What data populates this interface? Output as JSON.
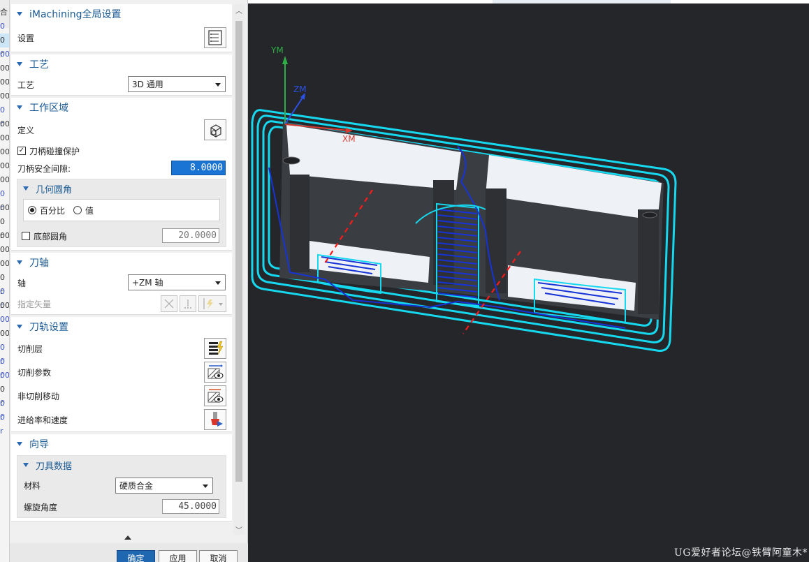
{
  "left_strip": {
    "rows": [
      {
        "text": "合",
        "style": "normal"
      },
      {
        "text": "0",
        "style": "blue"
      },
      {
        "text": "0 r",
        "style": "sel"
      },
      {
        "text": "00",
        "style": "blue"
      },
      {
        "text": "00",
        "style": "normal"
      },
      {
        "text": "00",
        "style": "normal"
      },
      {
        "text": "00",
        "style": "normal"
      },
      {
        "text": "0 r",
        "style": "blue"
      },
      {
        "text": "00",
        "style": "normal"
      },
      {
        "text": "00",
        "style": "normal"
      },
      {
        "text": "00",
        "style": "normal"
      },
      {
        "text": "00",
        "style": "normal"
      },
      {
        "text": "00",
        "style": "normal"
      },
      {
        "text": "0 r",
        "style": "blue"
      },
      {
        "text": "00",
        "style": "normal"
      },
      {
        "text": "0 r",
        "style": "normal"
      },
      {
        "text": "00",
        "style": "normal"
      },
      {
        "text": "00",
        "style": "normal"
      },
      {
        "text": "00",
        "style": "normal"
      },
      {
        "text": "0 r",
        "style": "normal"
      },
      {
        "text": "0 r",
        "style": "blue"
      },
      {
        "text": "00",
        "style": "normal"
      },
      {
        "text": "00",
        "style": "blue"
      },
      {
        "text": "00",
        "style": "normal"
      },
      {
        "text": "0 r",
        "style": "blue"
      },
      {
        "text": "0 r",
        "style": "blue"
      },
      {
        "text": "00",
        "style": "blue"
      },
      {
        "text": "0 r",
        "style": "normal"
      },
      {
        "text": "0 r",
        "style": "blue"
      },
      {
        "text": "0 r",
        "style": "blue"
      }
    ]
  },
  "dialog": {
    "global": {
      "title": "iMachining全局设置",
      "settings_label": "设置"
    },
    "process": {
      "title": "工艺",
      "label": "工艺",
      "value": "3D 通用"
    },
    "work_area": {
      "title": "工作区域",
      "define_label": "定义",
      "holder_collision_label": "刀柄碰撞保护",
      "holder_collision_checked": true,
      "holder_clearance_label": "刀柄安全间隙:",
      "holder_clearance_value": "8.0000",
      "fillet": {
        "title": "几何圆角",
        "radio_percent": "百分比",
        "radio_value": "值",
        "selected": "百分比",
        "bottom_fillet_label": "底部圆角",
        "bottom_fillet_checked": false,
        "bottom_fillet_value": "20.0000"
      }
    },
    "tool_axis": {
      "title": "刀轴",
      "axis_label": "轴",
      "axis_value": "+ZM 轴",
      "vector_label": "指定矢量"
    },
    "toolpath": {
      "title": "刀轨设置",
      "cut_levels": "切削层",
      "cut_params": "切削参数",
      "non_cut_moves": "非切削移动",
      "feeds_speeds": "进给率和速度"
    },
    "wizard": {
      "title": "向导",
      "tool_data": {
        "title": "刀具数据",
        "material_label": "材料",
        "material_value": "硬质合金",
        "helix_label": "螺旋角度",
        "helix_value": "45.0000"
      }
    },
    "footer": {
      "ok": "确定",
      "apply": "应用",
      "cancel": "取消"
    }
  },
  "viewport": {
    "axis_labels": {
      "y": "YM",
      "z": "ZM",
      "x": "XM"
    },
    "watermark": "UG爱好者论坛@铁臂阿童木*",
    "colors": {
      "background": "#24262a",
      "toolpath_outer": "#16d8ee",
      "toolpath_inner": "#1533d6",
      "part_face": "#eef1f6",
      "part_wall": "#3a3d42",
      "axis_x": "#d43a2f",
      "axis_y": "#2fae47",
      "axis_z": "#2c50e6",
      "center_line": "#ff1a1a"
    }
  }
}
